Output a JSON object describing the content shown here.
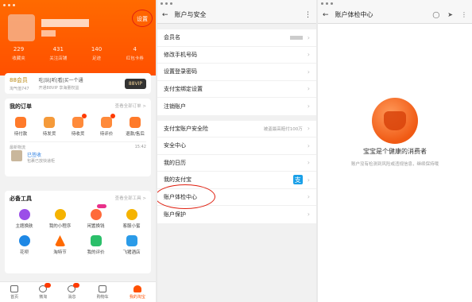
{
  "panel1": {
    "settings_label": "设置",
    "stats": [
      {
        "value": "229",
        "label": "收藏夹"
      },
      {
        "value": "431",
        "label": "关注店铺"
      },
      {
        "value": "140",
        "label": "足迹"
      },
      {
        "value": "4",
        "label": "红包卡券"
      }
    ],
    "vip": {
      "score": "88会员",
      "score_sub": "淘气值747",
      "mid": "吃|玩|听|看|买一个通",
      "mid_sub": "开通88VIP 享海量权益",
      "badge": "88VIP"
    },
    "orders": {
      "title": "我的订单",
      "more": "查看全部订单 >",
      "items": [
        {
          "label": "待付款",
          "color": "#ff7a2a"
        },
        {
          "label": "待发货",
          "color": "#f59a3a"
        },
        {
          "label": "待收货",
          "color": "#ff8a3a"
        },
        {
          "label": "待评价",
          "color": "#ff8a3a"
        },
        {
          "label": "退款/售后",
          "color": "#ff7a2a"
        }
      ],
      "logistics_head": "最新物流",
      "logistics_time": "15:42",
      "logistics_status": "已签收",
      "logistics_desc": "包裹已放快递柜"
    },
    "tools": {
      "title": "必备工具",
      "more": "查看全部工具 >",
      "row1": [
        {
          "label": "主题换肤",
          "color": "#9b4ee8"
        },
        {
          "label": "我的小程序",
          "color": "#f5b300"
        },
        {
          "label": "闲置换钱",
          "color": "#ff6a3a"
        },
        {
          "label": "客服小蜜",
          "color": "#f5b300"
        }
      ],
      "row2": [
        {
          "label": "花呗",
          "color": "#1e88e5"
        },
        {
          "label": "淘特节",
          "color": "#ff6a00"
        },
        {
          "label": "我的评价",
          "color": "#2bbf6a"
        },
        {
          "label": "飞猪酒店",
          "color": "#2b9be8"
        }
      ]
    },
    "tabbar": [
      {
        "label": "首页"
      },
      {
        "label": "微淘"
      },
      {
        "label": "消息"
      },
      {
        "label": "购物车"
      },
      {
        "label": "我的淘宝"
      }
    ]
  },
  "panel2": {
    "title": "账户与安全",
    "group1": [
      {
        "label": "会员名"
      },
      {
        "label": "修改手机号码"
      },
      {
        "label": "设置登录密码"
      },
      {
        "label": "支付宝绑定设置"
      },
      {
        "label": "注销账户"
      }
    ],
    "group2": [
      {
        "label": "支付宝账户安全险",
        "value": "被盗最高赔付100万"
      },
      {
        "label": "安全中心"
      },
      {
        "label": "我的日历"
      },
      {
        "label": "我的支付宝"
      },
      {
        "label": "账户体检中心"
      },
      {
        "label": "账户保护"
      }
    ],
    "alipay_glyph": "支"
  },
  "panel3": {
    "title": "账户体检中心",
    "headline": "宝宝是个健康的消费者",
    "subtext": "账户没有检测到风险或违规信息，继续保持哦"
  },
  "icons": {
    "back": "arrow-left-icon",
    "chevron": "chevron-right-icon",
    "kebab": "kebab-menu-icon"
  },
  "colors": {
    "brand_orange": "#ff5000",
    "highlight_ring": "#e02010",
    "alipay_blue": "#1aa0e8"
  }
}
